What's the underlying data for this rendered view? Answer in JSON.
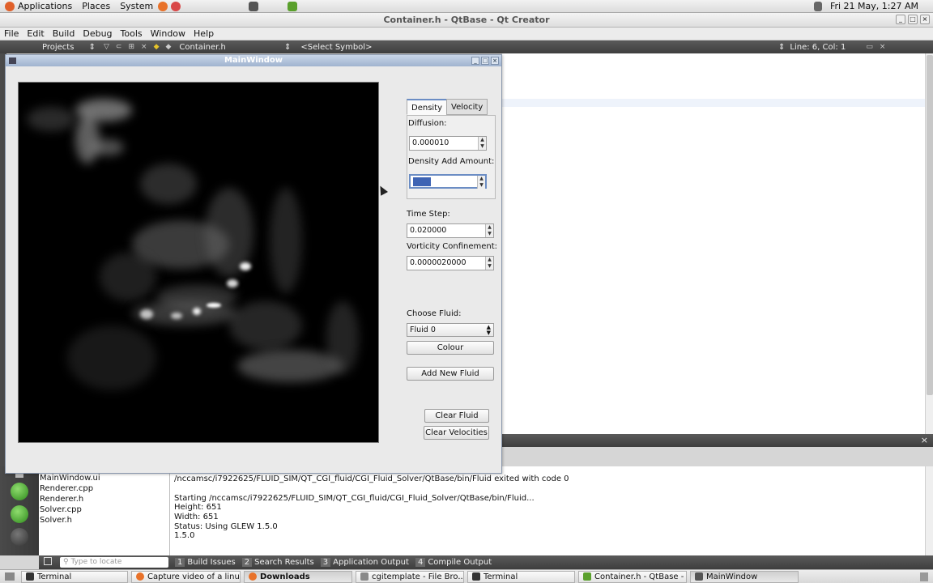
{
  "top_panel": {
    "applications": "Applications",
    "places": "Places",
    "system": "System",
    "clock": "Fri 21 May,  1:27 AM"
  },
  "qt_window": {
    "title": "Container.h - QtBase - Qt Creator",
    "menu": [
      "File",
      "Edit",
      "Build",
      "Debug",
      "Tools",
      "Window",
      "Help"
    ],
    "toolbar": {
      "projects_combo": "Projects",
      "file_combo": "Container.h",
      "symbol_combo": "<Select Symbol>",
      "position": "Line: 6, Col: 1"
    },
    "files": [
      "MainWindow.ui",
      "Renderer.cpp",
      "Renderer.h",
      "Solver.cpp",
      "Solver.h"
    ],
    "output_lines": [
      "/nccamsc/i7922625/FLUID_SIM/QT_CGI_fluid/CGI_Fluid_Solver/QtBase/bin/Fluid exited with code 0",
      "",
      "Starting /nccamsc/i7922625/FLUID_SIM/QT_CGI_fluid/CGI_Fluid_Solver/QtBase/bin/Fluid...",
      "Height: 651",
      "Width: 651",
      "Status: Using GLEW 1.5.0",
      "1.5.0"
    ],
    "status_bar": {
      "locator_placeholder": "Type to locate",
      "tabs": [
        {
          "num": "1",
          "label": "Build Issues"
        },
        {
          "num": "2",
          "label": "Search Results"
        },
        {
          "num": "3",
          "label": "Application Output"
        },
        {
          "num": "4",
          "label": "Compile Output"
        }
      ]
    }
  },
  "main_window": {
    "title": "MainWindow",
    "tabs": [
      "Density",
      "Velocity"
    ],
    "diffusion_label": "Diffusion:",
    "diffusion_value": "0.000010",
    "density_add_label": "Density Add Amount:",
    "density_add_value": "",
    "time_step_label": "Time Step:",
    "time_step_value": "0.020000",
    "vorticity_label": "Vorticity Confinement:",
    "vorticity_value": "0.0000020000",
    "choose_fluid_label": "Choose Fluid:",
    "choose_fluid_value": "Fluid 0",
    "colour_button": "Colour",
    "add_fluid_button": "Add New Fluid",
    "clear_fluid_button": "Clear Fluid",
    "clear_velocities_button": "Clear Velocities"
  },
  "taskbar": [
    {
      "label": "Terminal",
      "icon_color": "#333333",
      "bold": false,
      "active": false
    },
    {
      "label": "Capture video of a linu...",
      "icon_color": "#e8722a",
      "bold": false,
      "active": false
    },
    {
      "label": "Downloads",
      "icon_color": "#e8722a",
      "bold": true,
      "active": true
    },
    {
      "label": "cgitemplate - File Bro...",
      "icon_color": "#888888",
      "bold": false,
      "active": false
    },
    {
      "label": "Terminal",
      "icon_color": "#333333",
      "bold": false,
      "active": false
    },
    {
      "label": "Container.h - QtBase - ...",
      "icon_color": "#5aa02c",
      "bold": false,
      "active": false
    },
    {
      "label": "MainWindow",
      "icon_color": "#555555",
      "bold": false,
      "active": true
    }
  ]
}
